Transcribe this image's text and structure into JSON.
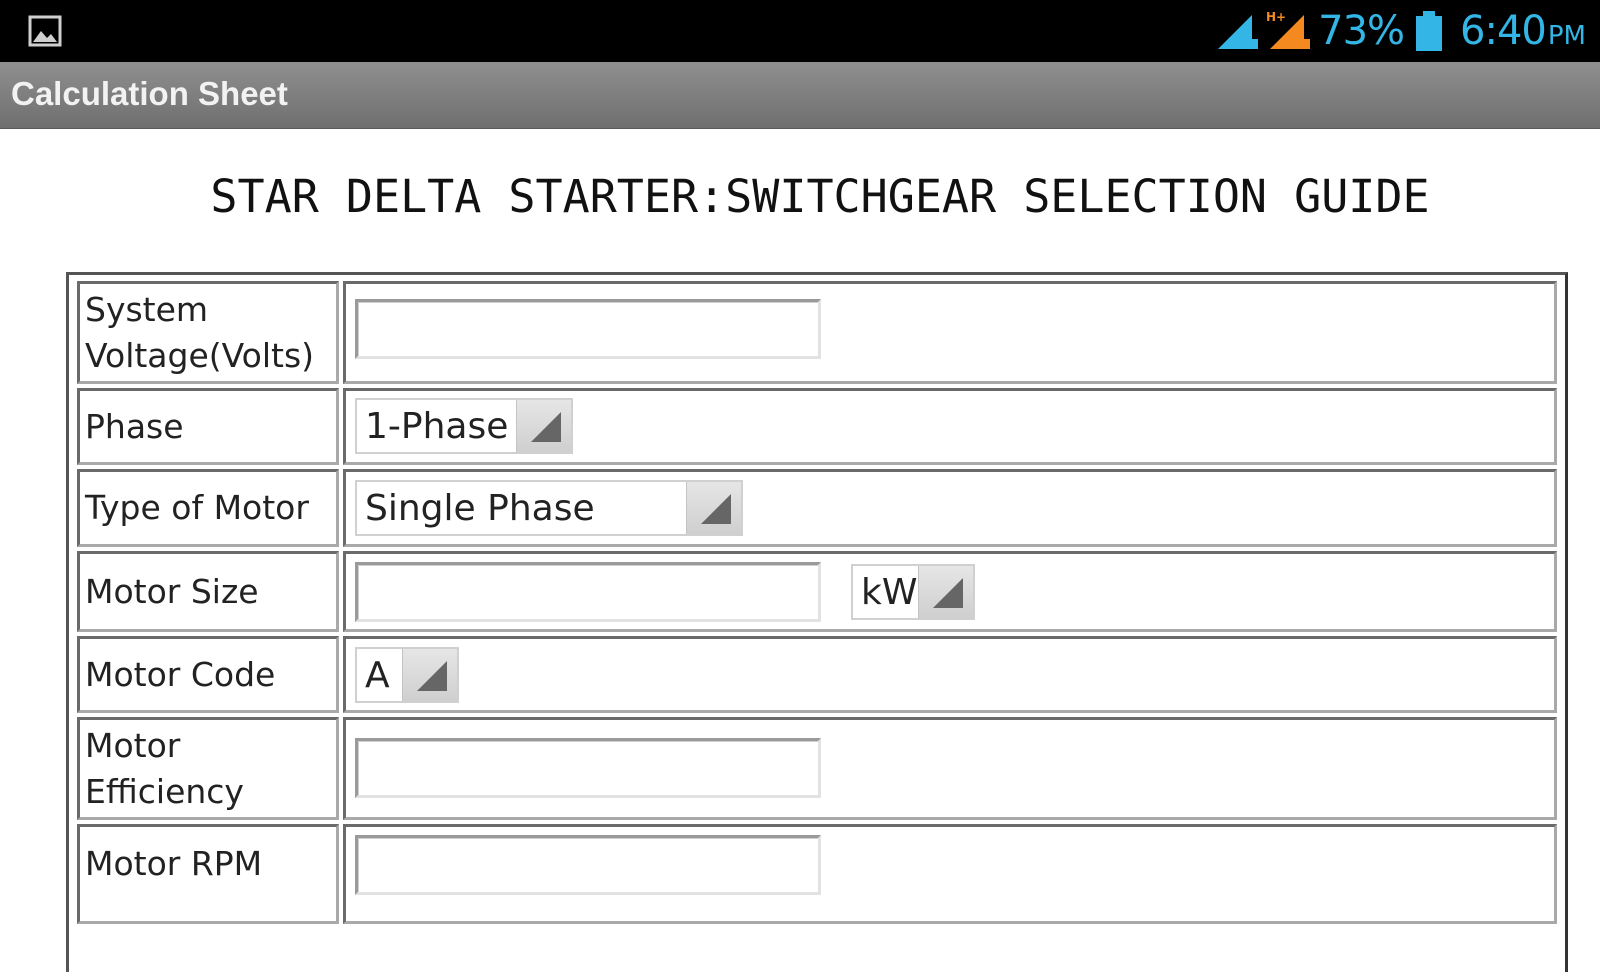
{
  "status_bar": {
    "battery_percent": "73%",
    "time": "6:40",
    "time_suffix": "PM",
    "accent_color": "#33b5e5",
    "icons": [
      "image-notification-icon",
      "signal-sim1-icon",
      "signal-sim2-hplus-icon",
      "battery-icon"
    ]
  },
  "action_bar": {
    "title": "Calculation Sheet"
  },
  "page": {
    "heading": "STAR DELTA STARTER:SWITCHGEAR SELECTION GUIDE"
  },
  "form": {
    "system_voltage": {
      "label": "System\nVoltage(Volts)",
      "value": ""
    },
    "phase": {
      "label": "Phase",
      "selected": "1-Phase"
    },
    "type_of_motor": {
      "label": "Type of Motor",
      "selected": "Single Phase"
    },
    "motor_size": {
      "label": "Motor Size",
      "value": "",
      "unit_selected": "kW"
    },
    "motor_code": {
      "label": "Motor Code",
      "selected": "A"
    },
    "motor_efficiency": {
      "label": "Motor\nEfficiency",
      "value": ""
    },
    "motor_rpm": {
      "label": "Motor RPM",
      "value": ""
    }
  }
}
